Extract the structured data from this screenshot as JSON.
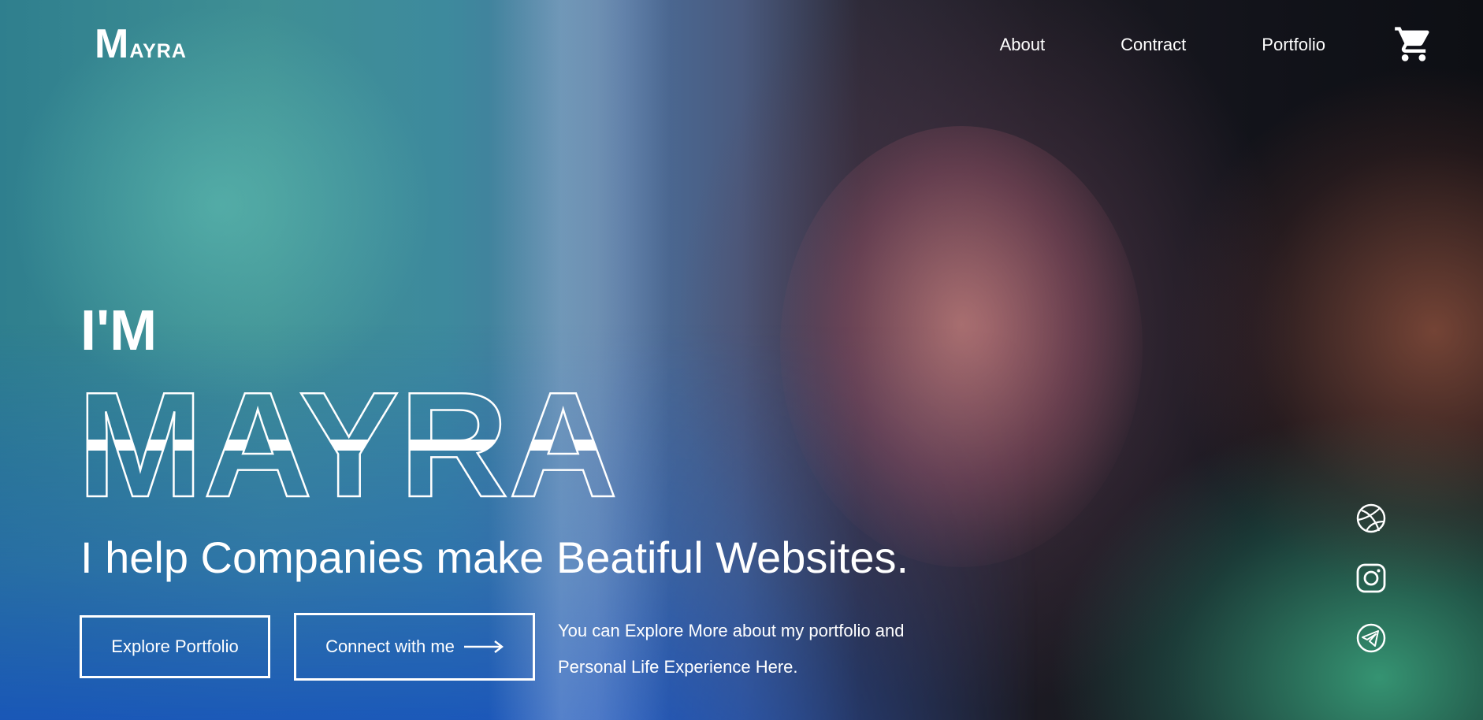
{
  "header": {
    "logo": {
      "initial": "M",
      "rest": "ayra"
    },
    "nav": [
      {
        "label": "About"
      },
      {
        "label": "Contract"
      },
      {
        "label": "Portfolio"
      }
    ],
    "cart_icon": "shopping-cart-icon"
  },
  "hero": {
    "intro": "I'M",
    "name": "MAYRA",
    "tagline": "I help Companies make Beatiful Websites.",
    "buttons": {
      "explore": "Explore Portfolio",
      "connect": "Connect with me"
    },
    "description": "You can Explore More about my portfolio and Personal Life Experience Here."
  },
  "social": [
    {
      "icon": "dribbble-icon"
    },
    {
      "icon": "instagram-icon"
    },
    {
      "icon": "telegram-icon"
    }
  ],
  "colors": {
    "text": "#ffffff",
    "overlay_blue": "#1f5ec4",
    "accent_teal": "#3fa98a"
  }
}
